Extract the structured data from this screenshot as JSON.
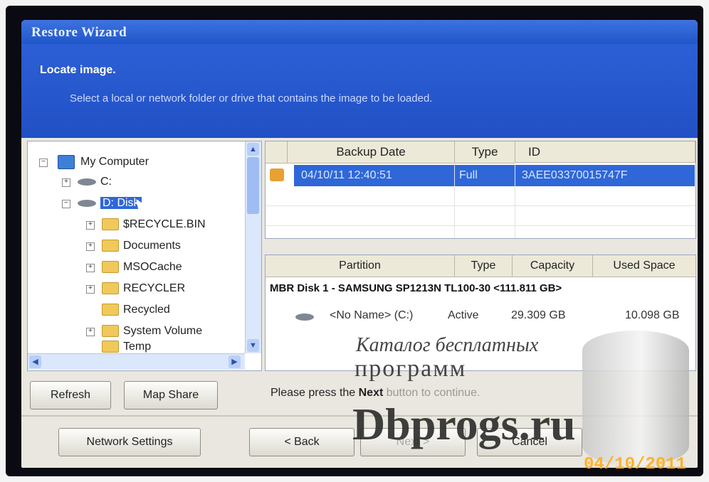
{
  "window": {
    "title": "Restore Wizard",
    "heading": "Locate image.",
    "subheading": "Select a local or network folder or drive that contains the image to be loaded."
  },
  "tree": {
    "root": "My Computer",
    "drive_c": "C:",
    "drive_d": "D: Disk",
    "folders": [
      "$RECYCLE.BIN",
      "Documents",
      "MSOCache",
      "RECYCLER",
      "Recycled",
      "System Volume",
      "Temp"
    ]
  },
  "backups": {
    "columns": [
      "Backup Date",
      "Type",
      "ID"
    ],
    "rows": [
      {
        "date": "04/10/11 12:40:51",
        "type": "Full",
        "id": "3AEE03370015747F"
      }
    ]
  },
  "partitions": {
    "columns": [
      "Partition",
      "Type",
      "Capacity",
      "Used Space"
    ],
    "disk_label": "MBR Disk 1  - SAMSUNG SP1213N TL100-30  <111.811 GB>",
    "rows": [
      {
        "name": "<No Name> (C:)",
        "type": "Active",
        "capacity": "29.309 GB",
        "used": "10.098 GB"
      }
    ]
  },
  "buttons": {
    "refresh": "Refresh",
    "map_share": "Map Share",
    "network_settings": "Network Settings",
    "back": "< Back",
    "next": "Next >",
    "cancel": "Cancel"
  },
  "message": {
    "prefix": "Please press the ",
    "next_word": "Next",
    "suffix": " button to continue."
  },
  "watermark": {
    "line1": "Каталог бесплатных",
    "line2": "программ",
    "site": "Dbprogs.ru"
  },
  "photo_date": "04/10/2011"
}
